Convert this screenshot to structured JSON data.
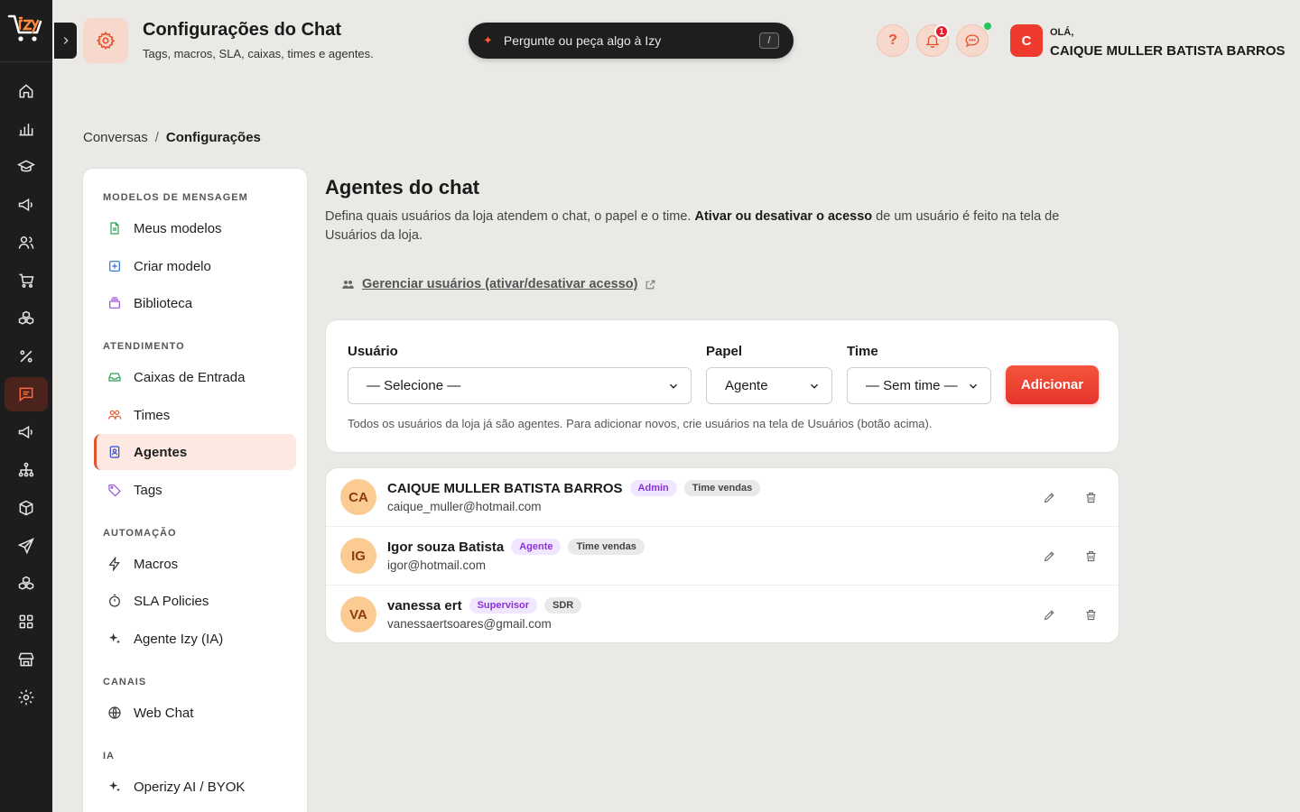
{
  "header": {
    "title": "Configurações do Chat",
    "subtitle": "Tags, macros, SLA, caixas, times e agentes.",
    "search_placeholder": "Pergunte ou peça algo à Izy",
    "search_shortcut": "/",
    "help_label": "?",
    "notification_count": "1",
    "greeting": "OLÁ,",
    "user_name": "CAIQUE MULLER BATISTA BARROS",
    "user_initial": "C"
  },
  "colors": {
    "accent": "#e5532f",
    "rail": "#1d1d1d",
    "background": "#ebe9e6"
  },
  "breadcrumb": {
    "parent": "Conversas",
    "separator": "/",
    "current": "Configurações"
  },
  "menu": {
    "sections": [
      {
        "title": "MODELOS DE MENSAGEM",
        "items": [
          {
            "label": "Meus modelos",
            "icon": "document-icon"
          },
          {
            "label": "Criar modelo",
            "icon": "plus-square-icon"
          },
          {
            "label": "Biblioteca",
            "icon": "library-icon"
          }
        ]
      },
      {
        "title": "ATENDIMENTO",
        "items": [
          {
            "label": "Caixas de Entrada",
            "icon": "inbox-icon"
          },
          {
            "label": "Times",
            "icon": "team-icon"
          },
          {
            "label": "Agentes",
            "icon": "agent-icon",
            "active": true
          },
          {
            "label": "Tags",
            "icon": "tag-icon"
          }
        ]
      },
      {
        "title": "AUTOMAÇÃO",
        "items": [
          {
            "label": "Macros",
            "icon": "bolt-icon"
          },
          {
            "label": "SLA Policies",
            "icon": "timer-icon"
          },
          {
            "label": "Agente Izy (IA)",
            "icon": "sparkle-icon"
          }
        ]
      },
      {
        "title": "CANAIS",
        "items": [
          {
            "label": "Web Chat",
            "icon": "globe-icon"
          }
        ]
      },
      {
        "title": "IA",
        "items": [
          {
            "label": "Operizy AI / BYOK",
            "icon": "sparkle-icon"
          }
        ]
      }
    ]
  },
  "main": {
    "title": "Agentes do chat",
    "desc_part1": "Defina quais usuários da loja atendem o chat, o papel e o time. ",
    "desc_bold": "Ativar ou desativar o acesso",
    "desc_part2": " de um usuário é feito na tela de Usuários da loja.",
    "manage_link": "Gerenciar usuários (ativar/desativar acesso)",
    "form": {
      "user_label": "Usuário",
      "user_value": "— Selecione —",
      "role_label": "Papel",
      "role_value": "Agente",
      "team_label": "Time",
      "team_value": "— Sem time —",
      "add_button": "Adicionar",
      "hint": "Todos os usuários da loja já são agentes. Para adicionar novos, crie usuários na tela de Usuários (botão acima)."
    },
    "agents": [
      {
        "initials": "CA",
        "name": "CAIQUE MULLER BATISTA BARROS",
        "role": "Admin",
        "team": "Time vendas",
        "email": "caique_muller@hotmail.com"
      },
      {
        "initials": "IG",
        "name": "Igor souza Batista",
        "role": "Agente",
        "team": "Time vendas",
        "email": "igor@hotmail.com"
      },
      {
        "initials": "VA",
        "name": "vanessa ert",
        "role": "Supervisor",
        "team": "SDR",
        "email": "vanessaertsoares@gmail.com"
      }
    ]
  }
}
